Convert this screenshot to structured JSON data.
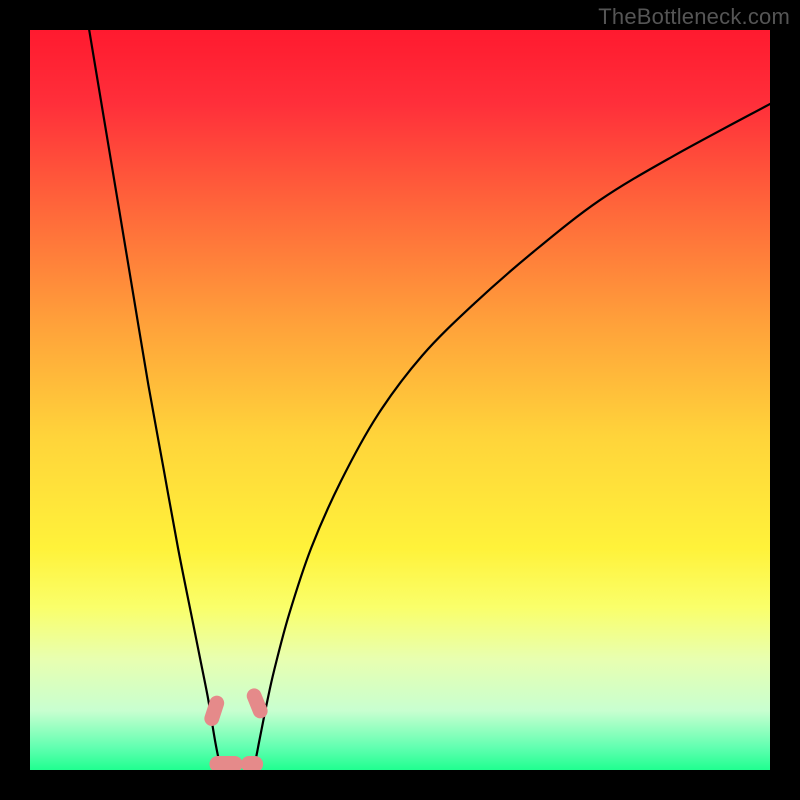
{
  "watermark": "TheBottleneck.com",
  "chart_data": {
    "type": "line",
    "title": "",
    "xlabel": "",
    "ylabel": "",
    "xlim": [
      0,
      100
    ],
    "ylim": [
      0,
      100
    ],
    "background_gradient": {
      "stops": [
        {
          "offset": 0.0,
          "color": "#ff1a2f"
        },
        {
          "offset": 0.1,
          "color": "#ff2f3a"
        },
        {
          "offset": 0.25,
          "color": "#ff6a3a"
        },
        {
          "offset": 0.4,
          "color": "#ffa23a"
        },
        {
          "offset": 0.55,
          "color": "#ffd43a"
        },
        {
          "offset": 0.7,
          "color": "#fff23a"
        },
        {
          "offset": 0.78,
          "color": "#faff6a"
        },
        {
          "offset": 0.85,
          "color": "#e8ffb0"
        },
        {
          "offset": 0.92,
          "color": "#c8ffd0"
        },
        {
          "offset": 0.97,
          "color": "#60ffb0"
        },
        {
          "offset": 1.0,
          "color": "#20ff90"
        }
      ]
    },
    "series": [
      {
        "name": "left-arc",
        "stroke": "#000000",
        "stroke_width": 2.2,
        "points": [
          {
            "x": 8.0,
            "y": 100.0
          },
          {
            "x": 10.0,
            "y": 88.0
          },
          {
            "x": 12.0,
            "y": 76.0
          },
          {
            "x": 14.0,
            "y": 64.0
          },
          {
            "x": 16.0,
            "y": 52.0
          },
          {
            "x": 18.0,
            "y": 41.0
          },
          {
            "x": 20.0,
            "y": 30.0
          },
          {
            "x": 22.0,
            "y": 20.0
          },
          {
            "x": 23.0,
            "y": 15.0
          },
          {
            "x": 24.0,
            "y": 10.0
          },
          {
            "x": 24.5,
            "y": 7.0
          },
          {
            "x": 25.0,
            "y": 4.0
          },
          {
            "x": 25.5,
            "y": 1.5
          },
          {
            "x": 26.0,
            "y": 0.0
          }
        ]
      },
      {
        "name": "right-arc",
        "stroke": "#000000",
        "stroke_width": 2.2,
        "points": [
          {
            "x": 30.0,
            "y": 0.0
          },
          {
            "x": 30.5,
            "y": 1.5
          },
          {
            "x": 31.0,
            "y": 4.0
          },
          {
            "x": 32.0,
            "y": 9.0
          },
          {
            "x": 33.0,
            "y": 13.5
          },
          {
            "x": 35.0,
            "y": 21.0
          },
          {
            "x": 38.0,
            "y": 30.0
          },
          {
            "x": 42.0,
            "y": 39.0
          },
          {
            "x": 47.0,
            "y": 48.0
          },
          {
            "x": 53.0,
            "y": 56.0
          },
          {
            "x": 60.0,
            "y": 63.0
          },
          {
            "x": 68.0,
            "y": 70.0
          },
          {
            "x": 77.0,
            "y": 77.0
          },
          {
            "x": 87.0,
            "y": 83.0
          },
          {
            "x": 100.0,
            "y": 90.0
          }
        ]
      }
    ],
    "markers": [
      {
        "name": "m1",
        "shape": "pill",
        "color": "#e58a8a",
        "x": 24.9,
        "y": 8.0,
        "w": 2.0,
        "h": 4.2,
        "rot": 18
      },
      {
        "name": "m2",
        "shape": "pill",
        "color": "#e58a8a",
        "x": 30.7,
        "y": 9.0,
        "w": 2.0,
        "h": 4.2,
        "rot": -22
      },
      {
        "name": "m3",
        "shape": "pill",
        "color": "#e58a8a",
        "x": 26.5,
        "y": 0.8,
        "w": 4.5,
        "h": 2.2,
        "rot": 0
      },
      {
        "name": "m4",
        "shape": "pill",
        "color": "#e58a8a",
        "x": 30.0,
        "y": 0.8,
        "w": 3.0,
        "h": 2.2,
        "rot": 0
      }
    ]
  }
}
